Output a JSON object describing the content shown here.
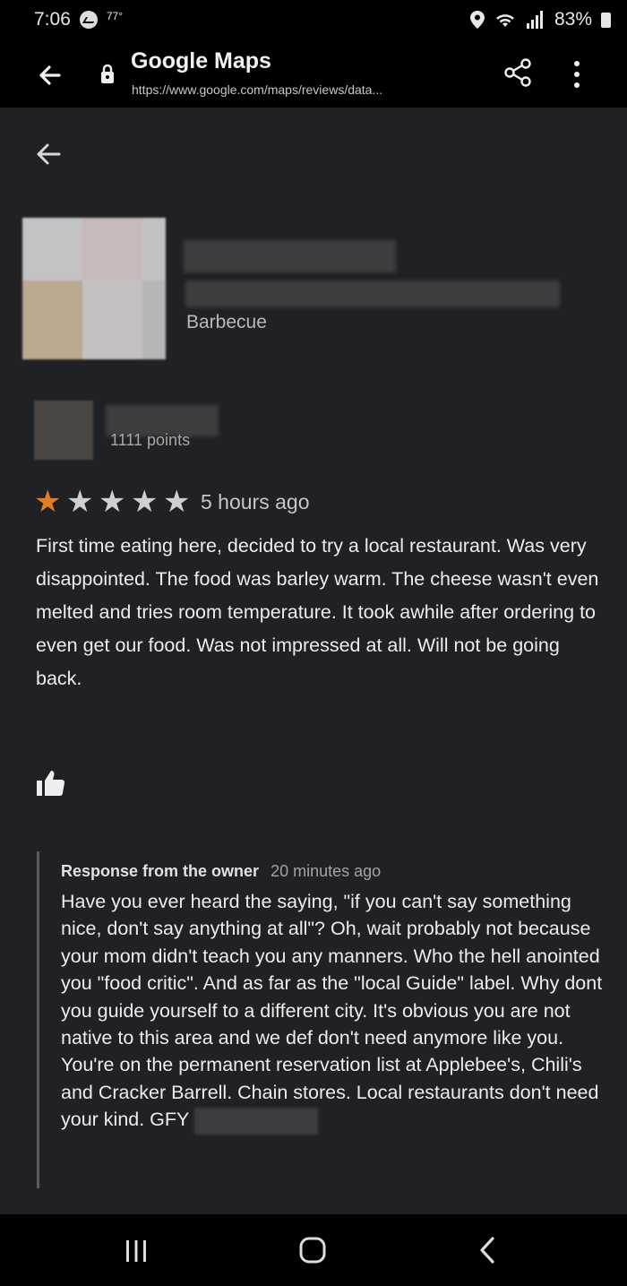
{
  "status_bar": {
    "time": "7:06",
    "temperature": "77°",
    "battery": "83%"
  },
  "browser": {
    "title": "Google Maps",
    "url": "https://www.google.com/maps/reviews/data..."
  },
  "place": {
    "category": "Barbecue"
  },
  "review": {
    "reviewer_points": "1111 points",
    "rating": 1,
    "rating_max": 5,
    "time": "5 hours ago",
    "text": "First time eating here, decided to try a local restaurant. Was very disappointed. The food was barley warm. The cheese wasn't even melted and tries room temperature. It took awhile after ordering to even get our food. Was not impressed at all. Will not be going back."
  },
  "owner_response": {
    "label": "Response from the owner",
    "time": "20 minutes ago",
    "text": "Have you ever heard the saying, \"if you can't say something nice, don't say anything at all\"? Oh, wait probably not because your mom didn't teach you any manners. Who the hell anointed you \"food critic\". And as far as the \"local Guide\" label. Why dont you guide yourself to a different city. It's obvious you are not native to this area and we def don't need anymore like you. You're on the permanent reservation list at Applebee's, Chili's and Cracker Barrell. Chain stores.  Local restaurants don't need your kind. GFY"
  },
  "colors": {
    "background": "#202124",
    "star_filled": "#e37c27",
    "star_empty": "#cfcfcf"
  },
  "icons": [
    "messenger-icon",
    "location-icon",
    "wifi-icon",
    "signal-icon",
    "battery-icon",
    "back-arrow-icon",
    "lock-icon",
    "share-icon",
    "more-vert-icon",
    "thumbs-up-icon",
    "recents-icon",
    "home-icon",
    "nav-back-icon"
  ]
}
